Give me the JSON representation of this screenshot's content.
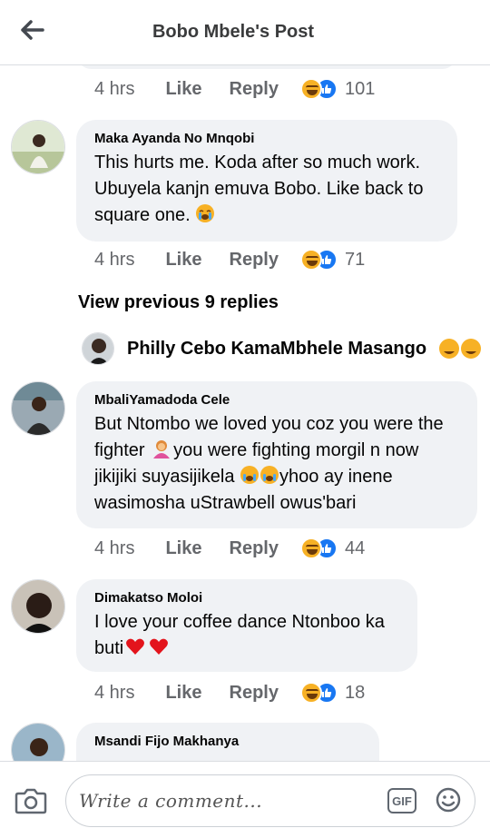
{
  "header": {
    "title": "Bobo Mbele's Post",
    "back_icon": "arrow-left-icon"
  },
  "reactions": {
    "icons": [
      "laughing-emoji-icon",
      "like-thumb-icon"
    ],
    "like_color": "#1877f2",
    "laugh_color": "#f7b125"
  },
  "top_meta": {
    "time": "4 hrs",
    "like": "Like",
    "reply": "Reply",
    "count": "101"
  },
  "comments": [
    {
      "author": "Maka Ayanda No Mnqobi",
      "text": "This hurts me. Koda after so much work. Ubuyela kanjn emuva Bobo. Like back to square one.",
      "emoji": "crying-emoji",
      "time": "4 hrs",
      "like": "Like",
      "reply": "Reply",
      "count": "71"
    },
    {
      "author": "MbaliYamadoda Cele",
      "text_1": "But Ntombo we loved you coz you were the fighter",
      "text_2": "you were fighting morgil n now jikijiki suyasijikela",
      "text_3": "yhoo ay inene wasimosha uStrawbell owus'bari",
      "time": "4 hrs",
      "like": "Like",
      "reply": "Reply",
      "count": "44"
    },
    {
      "author": "Dimakatso Moloi",
      "text": "I love your coffee dance Ntonboo ka buti",
      "time": "4 hrs",
      "like": "Like",
      "reply": "Reply",
      "count": "18"
    },
    {
      "author": "Msandi Fijo Makhanya"
    }
  ],
  "view_previous": "View previous 9 replies",
  "reply_head": {
    "name": "Philly Cebo KamaMbhele Masango"
  },
  "footer": {
    "placeholder": "Write a comment...",
    "gif": "GIF",
    "camera_icon": "camera-icon",
    "emoji_icon": "smiley-icon"
  }
}
